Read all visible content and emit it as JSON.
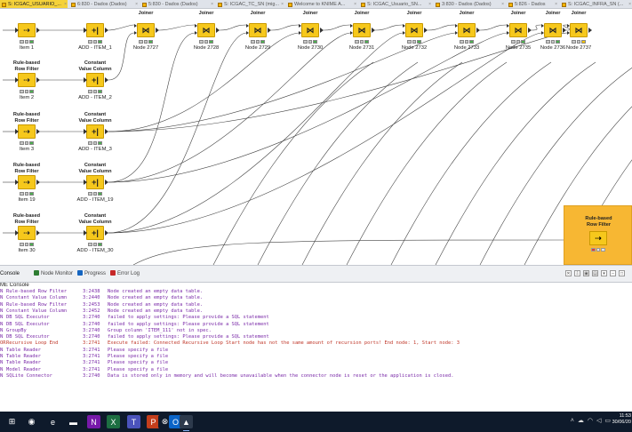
{
  "tabs": [
    {
      "label": "S: ICGAC_USUARIO_...",
      "active": true
    },
    {
      "label": "6:830 - Dados (Dados)",
      "active": false
    },
    {
      "label": "5:830 - Dados (Dados)",
      "active": false
    },
    {
      "label": "S: ICGAC_TC_SN (mig...",
      "active": false
    },
    {
      "label": "Welcome to KNIME A...",
      "active": false
    },
    {
      "label": "S: ICGAC_Usuario_SN...",
      "active": false
    },
    {
      "label": "3:830 - Dados (Dados)",
      "active": false
    },
    {
      "label": "5:826 - Dados",
      "active": false
    },
    {
      "label": "S: ICGAC_INFRA_SN (...",
      "active": false
    }
  ],
  "canvas": {
    "rule_rows": [
      {
        "title": "",
        "label": "Item 1"
      },
      {
        "title": "Rule-based\nRow Filter",
        "label": "Item 2"
      },
      {
        "title": "Rule-based\nRow Filter",
        "label": "Item 3"
      },
      {
        "title": "Rule-based\nRow Filter",
        "label": "Item 19"
      },
      {
        "title": "Rule-based\nRow Filter",
        "label": "Item 30"
      }
    ],
    "const_rows": [
      {
        "title": "",
        "label": "ADD - ITEM_1"
      },
      {
        "title": "Constant\nValue Column",
        "label": "ADD - ITEM_2"
      },
      {
        "title": "Constant\nValue Column",
        "label": "ADD - ITEM_3"
      },
      {
        "title": "Constant\nValue Column",
        "label": "ADD - ITEM_19"
      },
      {
        "title": "Constant\nValue Column",
        "label": "ADD - ITEM_30"
      }
    ],
    "joiners": [
      {
        "title": "Joiner",
        "label": "Node 2727",
        "status": "green"
      },
      {
        "title": "Joiner",
        "label": "Node 2728",
        "status": "green"
      },
      {
        "title": "Joiner",
        "label": "Node 2729",
        "status": "green"
      },
      {
        "title": "Joiner",
        "label": "Node 2730",
        "status": "green"
      },
      {
        "title": "Joiner",
        "label": "Node 2731",
        "status": "green"
      },
      {
        "title": "Joiner",
        "label": "Node 2732",
        "status": "green"
      },
      {
        "title": "Joiner",
        "label": "Node 2733",
        "status": "green"
      },
      {
        "title": "Joiner",
        "label": "Node 2735",
        "status": "green"
      },
      {
        "title": "Joiner",
        "label": "Node 2736",
        "status": "green"
      },
      {
        "title": "Joiner",
        "label": "Node 2737",
        "status": "yellow"
      }
    ],
    "metanode": {
      "title": "Rule-based\nRow Filter"
    }
  },
  "console_tabs": [
    {
      "label": "Console",
      "icon": "console-icon",
      "active": true
    },
    {
      "label": "Node Monitor",
      "icon": "node-monitor-icon",
      "active": false
    },
    {
      "label": "Progress",
      "icon": "progress-icon",
      "active": false
    },
    {
      "label": "Error Log",
      "icon": "error-log-icon",
      "active": false
    }
  ],
  "console": {
    "title": "ME Console",
    "lines": [
      {
        "level": "N",
        "node": "Rule-based Row Filter",
        "time": "3:2438",
        "msg": "Node created an empty data table.",
        "type": "info"
      },
      {
        "level": "N",
        "node": "Constant Value Column",
        "time": "3:2440",
        "msg": "Node created an empty data table.",
        "type": "info"
      },
      {
        "level": "N",
        "node": "Rule-based Row Filter",
        "time": "3:2453",
        "msg": "Node created an empty data table.",
        "type": "info"
      },
      {
        "level": "N",
        "node": "Constant Value Column",
        "time": "3:2452",
        "msg": "Node created an empty data table.",
        "type": "info"
      },
      {
        "level": "N",
        "node": "DB SQL Executor",
        "time": "3:2740",
        "msg": "failed to apply settings: Please provide a SQL statement",
        "type": "info"
      },
      {
        "level": "N",
        "node": "DB SQL Executor",
        "time": "3:2740",
        "msg": "failed to apply settings: Please provide a SQL statement",
        "type": "info"
      },
      {
        "level": "N",
        "node": "GroupBy",
        "time": "3:2740",
        "msg": "Group column 'ITEM_111' not in spec.",
        "type": "info"
      },
      {
        "level": "N",
        "node": "DB SQL Executor",
        "time": "3:2740",
        "msg": "failed to apply settings: Please provide a SQL statement",
        "type": "info"
      },
      {
        "level": "OR",
        "node": "Recursive Loop End",
        "time": "3:2741",
        "msg": "Execute failed: Connected Recursive Loop Start node has not the same amount of recursion ports! End node: 1, Start node: 3",
        "type": "error"
      },
      {
        "level": "N",
        "node": "Table Reader",
        "time": "3:2741",
        "msg": "Please specify a file",
        "type": "info"
      },
      {
        "level": "N",
        "node": "Table Reader",
        "time": "3:2741",
        "msg": "Please specify a file",
        "type": "info"
      },
      {
        "level": "N",
        "node": "Table Reader",
        "time": "3:2741",
        "msg": "Please specify a file",
        "type": "info"
      },
      {
        "level": "N",
        "node": "Model Reader",
        "time": "3:2741",
        "msg": "Please specify a file",
        "type": "info"
      },
      {
        "level": "N",
        "node": "SQLite Connector",
        "time": "3:2740",
        "msg": "Data is stored only in memory and will become unavailable when the connector node is reset or the application is closed.",
        "type": "info"
      }
    ]
  },
  "taskbar": {
    "apps": [
      {
        "name": "windows-start-icon",
        "glyph": "⊞",
        "color": "#0e1a2b"
      },
      {
        "name": "chrome-icon",
        "glyph": "◉",
        "color": "#0e1a2b"
      },
      {
        "name": "edge-icon",
        "glyph": "e",
        "color": "#0e1a2b"
      },
      {
        "name": "file-explorer-icon",
        "glyph": "▬",
        "color": "#0e1a2b"
      },
      {
        "name": "onenote-icon",
        "glyph": "N",
        "color": "#7719aa"
      },
      {
        "name": "excel-icon",
        "glyph": "X",
        "color": "#1d6f42"
      },
      {
        "name": "teams-icon",
        "glyph": "T",
        "color": "#4b53bc"
      },
      {
        "name": "powerpoint-icon",
        "glyph": "P",
        "color": "#c43e1c"
      },
      {
        "name": "xbox-icon",
        "glyph": "⊗",
        "color": "#0e1a2b"
      },
      {
        "name": "outlook-icon",
        "glyph": "O",
        "color": "#0a64c8"
      },
      {
        "name": "knime-icon",
        "glyph": "▲",
        "color": "#2d3a4c"
      }
    ],
    "time": "11:53",
    "date": "30/06/20"
  },
  "colors": {
    "node_yellow": "#f6c81c",
    "metanode_orange": "#f7b733",
    "info_text": "#7a2aa8",
    "error_text": "#c0392b"
  }
}
